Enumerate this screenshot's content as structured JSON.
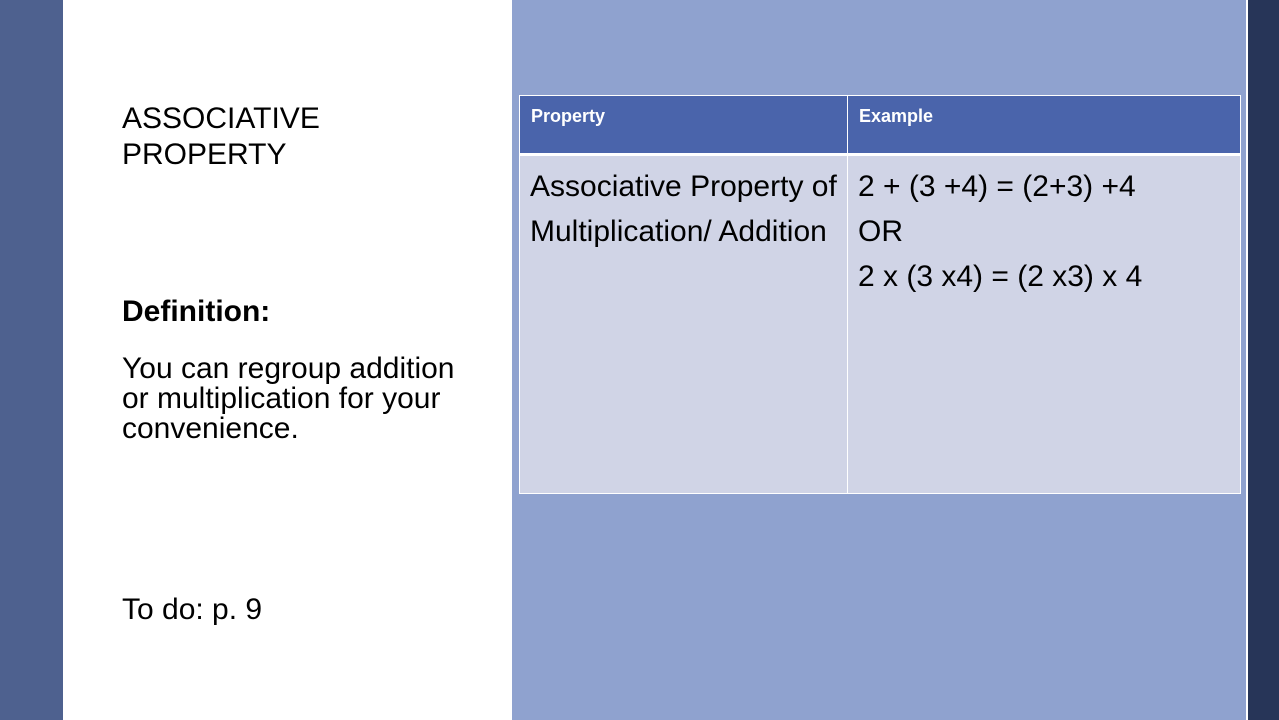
{
  "slide": {
    "title": "ASSOCIATIVE PROPERTY",
    "definition_label": "Definition:",
    "definition_text": "You can regroup addition or multiplication for your convenience.",
    "todo": "To do:  p. 9",
    "colors": {
      "left_bar": "#4e618f",
      "right_panel": "#8fa2cf",
      "right_bar": "#273558",
      "table_header": "#4a64ab",
      "table_body": "#d0d4e6"
    }
  },
  "table": {
    "headers": [
      "Property",
      "Example"
    ],
    "rows": [
      {
        "property": "Associative Property of Multiplication/ Addition",
        "example_lines": [
          "2 + (3 +4) = (2+3) +4",
          "OR",
          "2 x (3 x4) = (2 x3) x 4"
        ]
      }
    ]
  }
}
